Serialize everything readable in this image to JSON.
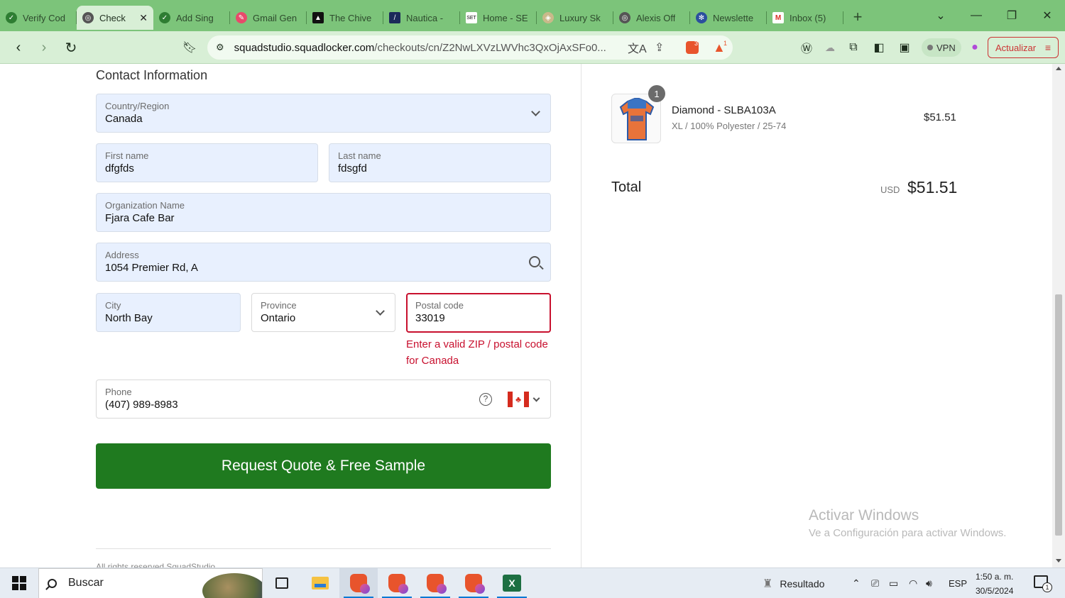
{
  "browser": {
    "tabs": [
      {
        "label": "Verify Cod",
        "favicon": "check-green"
      },
      {
        "label": "Check",
        "favicon": "globe",
        "active": true
      },
      {
        "label": "Add Sing",
        "favicon": "check-green"
      },
      {
        "label": "Gmail Gen",
        "favicon": "feather"
      },
      {
        "label": "The Chive",
        "favicon": "chive"
      },
      {
        "label": "Nautica -",
        "favicon": "nautica"
      },
      {
        "label": "Home - SE",
        "favicon": "set"
      },
      {
        "label": "Luxury Sk",
        "favicon": "luxury"
      },
      {
        "label": "Alexis Off",
        "favicon": "globe"
      },
      {
        "label": "Newslette",
        "favicon": "gear"
      },
      {
        "label": "Inbox (5)",
        "favicon": "gmail"
      }
    ],
    "url_host": "squadstudio.squadlocker.com",
    "url_path": "/checkouts/cn/Z2NwLXVzLWVhc3QxOjAxSFo0...",
    "brave_shield_count": "3",
    "rewards_count": "1",
    "vpn_label": "VPN",
    "update_label": "Actualizar"
  },
  "form": {
    "section_title": "Contact Information",
    "country": {
      "label": "Country/Region",
      "value": "Canada"
    },
    "first_name": {
      "label": "First name",
      "value": "dfgfds"
    },
    "last_name": {
      "label": "Last name",
      "value": "fdsgfd"
    },
    "organization": {
      "label": "Organization Name",
      "value": "Fjara Cafe Bar"
    },
    "address": {
      "label": "Address",
      "value": "1054 Premier Rd, A"
    },
    "city": {
      "label": "City",
      "value": "North Bay"
    },
    "province": {
      "label": "Province",
      "value": "Ontario"
    },
    "postal": {
      "label": "Postal code",
      "value": "33019"
    },
    "postal_error": "Enter a valid ZIP / postal code for Canada",
    "phone": {
      "label": "Phone",
      "value": "(407) 989-8983"
    },
    "help_glyph": "?",
    "submit_label": "Request Quote & Free Sample",
    "footer": "All rights reserved SquadStudio"
  },
  "summary": {
    "item": {
      "quantity": "1",
      "name": "Diamond - SLBA103A",
      "meta": "XL / 100% Polyester / 25-74",
      "price": "$51.51"
    },
    "total_label": "Total",
    "currency": "USD",
    "total_value": "$51.51"
  },
  "watermark": {
    "line1": "Activar Windows",
    "line2": "Ve a Configuración para activar Windows."
  },
  "taskbar": {
    "search_placeholder": "Buscar",
    "weather_label": "Resultado",
    "language": "ESP",
    "time": "1:50 a. m.",
    "date": "30/5/2024",
    "notification_count": "1"
  }
}
